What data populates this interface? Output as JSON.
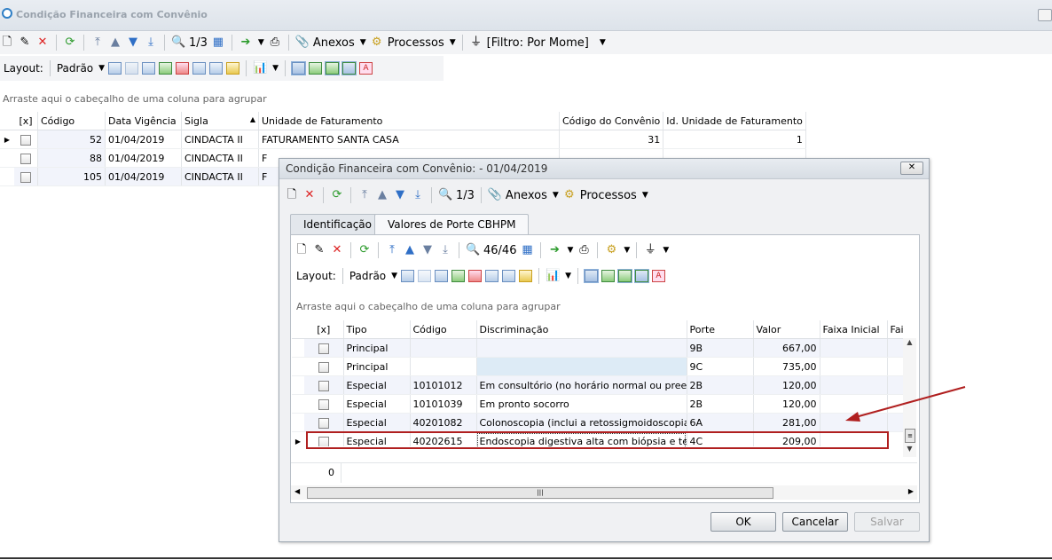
{
  "main": {
    "title": "Condição Financeira com Convênio",
    "toolbar": {
      "record_pos": "1/3",
      "anexos": "Anexos",
      "processos": "Processos",
      "filter": "[Filtro: Por Mome]"
    },
    "layout_label": "Layout:",
    "padrao_label": "Padrão",
    "group_hint": "Arraste aqui o cabeçalho de uma coluna para agrupar",
    "columns": [
      "[x]",
      "Código",
      "Data Vigência",
      "Sigla",
      "Unidade de Faturamento",
      "Código do Convênio",
      "Id. Unidade de Faturamento"
    ],
    "rows": [
      {
        "codigo": "52",
        "data": "01/04/2019",
        "sigla": "CINDACTA II",
        "unidade": "FATURAMENTO SANTA CASA",
        "cod_conv": "31",
        "id_unidade": "1"
      },
      {
        "codigo": "88",
        "data": "01/04/2019",
        "sigla": "CINDACTA II",
        "unidade": "F",
        "cod_conv": "",
        "id_unidade": ""
      },
      {
        "codigo": "105",
        "data": "01/04/2019",
        "sigla": "CINDACTA II",
        "unidade": "F",
        "cod_conv": "",
        "id_unidade": ""
      }
    ]
  },
  "dialog": {
    "title": "Condição Financeira com Convênio:  - 01/04/2019",
    "toolbar": {
      "record_pos": "1/3",
      "anexos": "Anexos",
      "processos": "Processos"
    },
    "tabs": [
      "Identificação",
      "Valores de Porte CBHPM"
    ],
    "inner_toolbar": {
      "record_pos": "46/46"
    },
    "layout_label": "Layout:",
    "padrao_label": "Padrão",
    "group_hint": "Arraste aqui o cabeçalho de uma coluna para agrupar",
    "columns": [
      "[x]",
      "Tipo",
      "Código",
      "Discriminação",
      "Porte",
      "Valor",
      "Faixa Inicial",
      "Faixa"
    ],
    "rows": [
      {
        "tipo": "Principal",
        "codigo": "",
        "disc": "",
        "porte": "9B",
        "valor": "667,00"
      },
      {
        "tipo": "Principal",
        "codigo": "",
        "disc": "",
        "porte": "9C",
        "valor": "735,00"
      },
      {
        "tipo": "Especial",
        "codigo": "10101012",
        "disc": "Em consultório (no horário normal ou preesta…",
        "porte": "2B",
        "valor": "120,00"
      },
      {
        "tipo": "Especial",
        "codigo": "10101039",
        "disc": "Em pronto socorro",
        "porte": "2B",
        "valor": "120,00"
      },
      {
        "tipo": "Especial",
        "codigo": "40201082",
        "disc": "Colonoscopia (inclui a retossigmoidoscopia)",
        "porte": "6A",
        "valor": "281,00"
      },
      {
        "tipo": "Especial",
        "codigo": "40202615",
        "disc": "Endoscopia digestiva alta com biópsia e teste…",
        "porte": "4C",
        "valor": "209,00"
      }
    ],
    "footer_count": "0",
    "buttons": {
      "ok": "OK",
      "cancel": "Cancelar",
      "save": "Salvar"
    }
  },
  "colors": {
    "accent_blue": "#2f7fc6",
    "highlight_red": "#b01f1f",
    "selected_cell": "#ddebf6"
  }
}
